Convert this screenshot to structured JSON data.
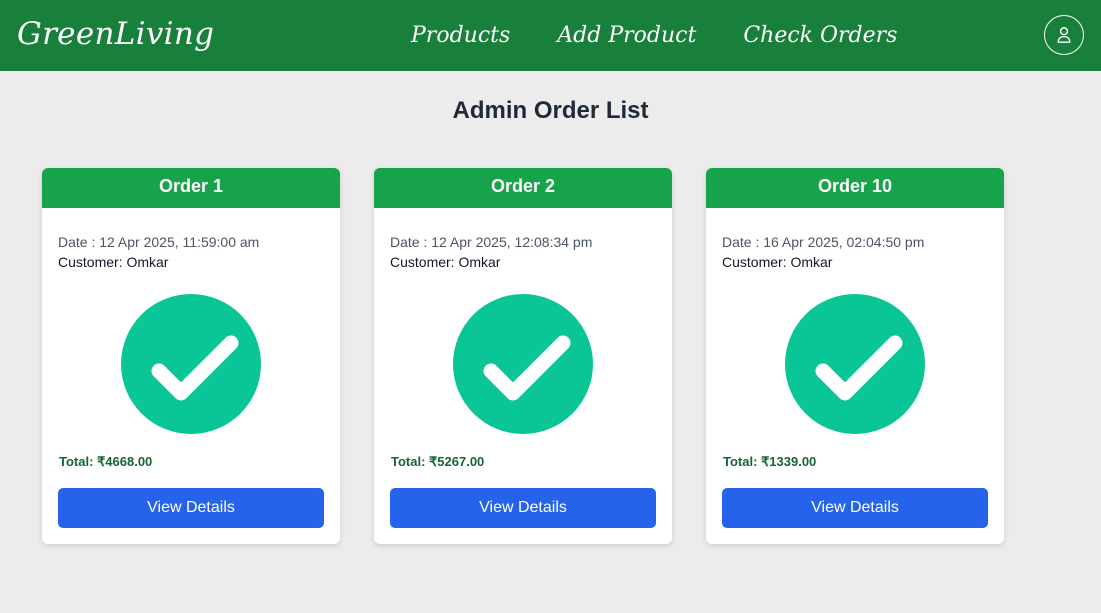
{
  "nav": {
    "brand": "GreenLiving",
    "links": [
      "Products",
      "Add Product",
      "Check Orders"
    ],
    "user_icon": "user-icon"
  },
  "page": {
    "title": "Admin Order List"
  },
  "orders": [
    {
      "title": "Order 1",
      "date": "Date : 12 Apr 2025, 11:59:00 am",
      "customer": "Customer: Omkar",
      "status_icon": "check-circle-icon",
      "total": "Total: ₹4668.00",
      "button": "View Details"
    },
    {
      "title": "Order 2",
      "date": "Date : 12 Apr 2025, 12:08:34 pm",
      "customer": "Customer: Omkar",
      "status_icon": "check-circle-icon",
      "total": "Total: ₹5267.00",
      "button": "View Details"
    },
    {
      "title": "Order 10",
      "date": "Date : 16 Apr 2025, 02:04:50 pm",
      "customer": "Customer: Omkar",
      "status_icon": "check-circle-icon",
      "total": "Total: ₹1339.00",
      "button": "View Details"
    }
  ],
  "colors": {
    "navbar": "#18803b",
    "card_header": "#16a34a",
    "status_circle": "#0ac595",
    "button": "#2563eb",
    "total_text": "#166534",
    "background": "#ececec"
  }
}
